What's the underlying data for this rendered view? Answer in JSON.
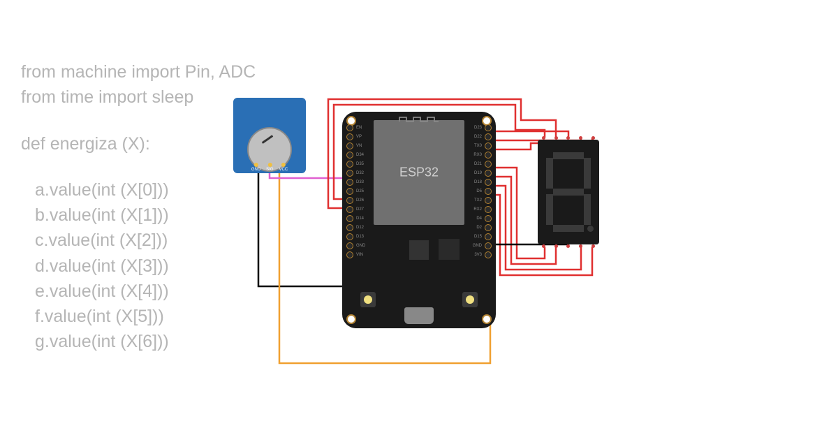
{
  "code": {
    "line1": "from machine import Pin, ADC",
    "line2": "from time     import sleep",
    "line3": "def energiza (X):",
    "body": [
      "a.value(int (X[0]))",
      "b.value(int (X[1]))",
      "c.value(int (X[2]))",
      "d.value(int (X[3]))",
      "e.value(int (X[4]))",
      "f.value(int (X[5]))",
      "g.value(int (X[6]))"
    ]
  },
  "potentiometer": {
    "pins": [
      "GND",
      "SIG",
      "VCC"
    ]
  },
  "esp32": {
    "label": "ESP32",
    "left_pins": [
      "EN",
      "VP",
      "VN",
      "D34",
      "D35",
      "D32",
      "D33",
      "D25",
      "D26",
      "D27",
      "D14",
      "D12",
      "D13",
      "GND",
      "VIN"
    ],
    "right_pins": [
      "D23",
      "D22",
      "TX0",
      "RX0",
      "D21",
      "D19",
      "D18",
      "D5",
      "TX2",
      "RX2",
      "D4",
      "D2",
      "D15",
      "GND",
      "3V3"
    ]
  },
  "seven_segment": {
    "segments": [
      "a",
      "b",
      "c",
      "d",
      "e",
      "f",
      "g",
      "dp"
    ]
  },
  "wires": {
    "colors": {
      "power": "#e03030",
      "signal": "#e060d0",
      "ground": "#000000",
      "vcc": "#f0a030"
    }
  }
}
